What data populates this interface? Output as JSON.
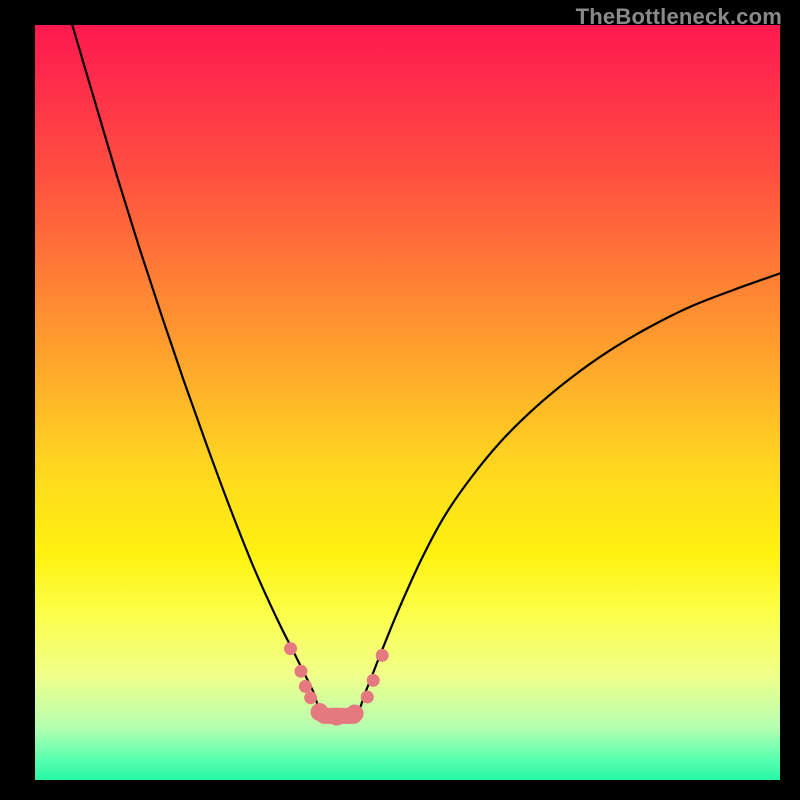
{
  "watermark": "TheBottleneck.com",
  "chart_data": {
    "type": "line",
    "title": "",
    "xlabel": "",
    "ylabel": "",
    "xlim": [
      0,
      100
    ],
    "ylim": [
      0,
      100
    ],
    "grid": false,
    "legend": false,
    "background_gradient_stops": [
      {
        "offset": 0.0,
        "color": "#ff1850"
      },
      {
        "offset": 0.2,
        "color": "#ff5040"
      },
      {
        "offset": 0.4,
        "color": "#ff9530"
      },
      {
        "offset": 0.58,
        "color": "#ffd520"
      },
      {
        "offset": 0.7,
        "color": "#fff210"
      },
      {
        "offset": 0.78,
        "color": "#fbff4a"
      },
      {
        "offset": 0.86,
        "color": "#f1ff8a"
      },
      {
        "offset": 0.93,
        "color": "#b6ffb0"
      },
      {
        "offset": 0.97,
        "color": "#5effb0"
      },
      {
        "offset": 1.0,
        "color": "#28f7a8"
      }
    ],
    "series": [
      {
        "name": "curve",
        "color": "#000000",
        "width": 2.2,
        "x": [
          5.0,
          8.0,
          11.0,
          14.0,
          17.0,
          20.0,
          23.0,
          26.0,
          29.0,
          31.0,
          33.0,
          35.0,
          37.3,
          38.8,
          42.8,
          44.5,
          46.5,
          49.0,
          52.0,
          55.0,
          58.5,
          62.5,
          67.0,
          72.0,
          77.0,
          82.5,
          88.0,
          94.0,
          100.0
        ],
        "y": [
          100.0,
          90.0,
          80.0,
          70.5,
          61.5,
          52.8,
          44.5,
          36.5,
          29.0,
          24.5,
          20.3,
          16.4,
          11.8,
          8.5,
          8.5,
          12.0,
          17.0,
          23.0,
          29.5,
          35.0,
          40.0,
          44.8,
          49.2,
          53.3,
          56.8,
          60.0,
          62.7,
          65.0,
          67.1
        ]
      }
    ],
    "flat_segment": {
      "x_start": 38.8,
      "x_end": 42.8,
      "y": 8.5
    },
    "markers": {
      "color": "#e47a7f",
      "radius_small": 6.5,
      "radius_large": 9.0,
      "points": [
        {
          "x": 34.3,
          "y": 17.4,
          "r": "small"
        },
        {
          "x": 35.7,
          "y": 14.4,
          "r": "small"
        },
        {
          "x": 36.3,
          "y": 12.4,
          "r": "small"
        },
        {
          "x": 37.0,
          "y": 10.9,
          "r": "small"
        },
        {
          "x": 38.2,
          "y": 9.0,
          "r": "large"
        },
        {
          "x": 40.5,
          "y": 8.4,
          "r": "large"
        },
        {
          "x": 42.9,
          "y": 8.8,
          "r": "large"
        },
        {
          "x": 44.6,
          "y": 11.0,
          "r": "small"
        },
        {
          "x": 45.4,
          "y": 13.2,
          "r": "small"
        },
        {
          "x": 46.6,
          "y": 16.5,
          "r": "small"
        }
      ]
    }
  }
}
